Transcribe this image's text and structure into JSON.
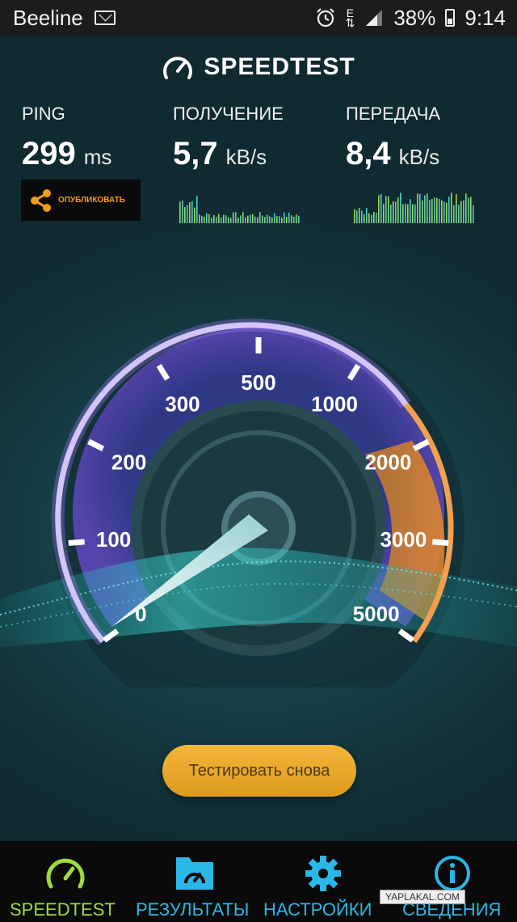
{
  "status_bar": {
    "carrier": "Beeline",
    "network": "E",
    "battery": "38%",
    "time": "9:14"
  },
  "app": {
    "title": "SPEEDTEST"
  },
  "metrics": {
    "ping": {
      "label": "PING",
      "value": "299",
      "unit": "ms"
    },
    "download": {
      "label": "ПОЛУЧЕНИЕ",
      "value": "5,7",
      "unit": "kB/s"
    },
    "upload": {
      "label": "ПЕРЕДАЧА",
      "value": "8,4",
      "unit": "kB/s"
    }
  },
  "share_button": {
    "label": "ОПУБЛИКОВАТЬ"
  },
  "gauge": {
    "ticks": [
      "0",
      "100",
      "200",
      "300",
      "500",
      "1000",
      "2000",
      "3000",
      "5000"
    ],
    "needle_tick_fraction": 0.0
  },
  "retest_button": {
    "label": "Тестировать снова"
  },
  "nav": [
    {
      "label": "SPEEDTEST",
      "icon": "gauge-icon",
      "active": true
    },
    {
      "label": "РЕЗУЛЬТАТЫ",
      "icon": "results-folder-icon",
      "active": false
    },
    {
      "label": "НАСТРОЙКИ",
      "icon": "gear-icon",
      "active": false
    },
    {
      "label": "СВЕДЕНИЯ",
      "icon": "info-icon",
      "active": false
    }
  ],
  "watermark": "YAPLAKAL.COM",
  "colors": {
    "accent_orange": "#f29a1a",
    "nav_active": "#9ddc3c",
    "nav_inactive": "#29b8e8",
    "arc_purple": "#7a5ad8"
  }
}
